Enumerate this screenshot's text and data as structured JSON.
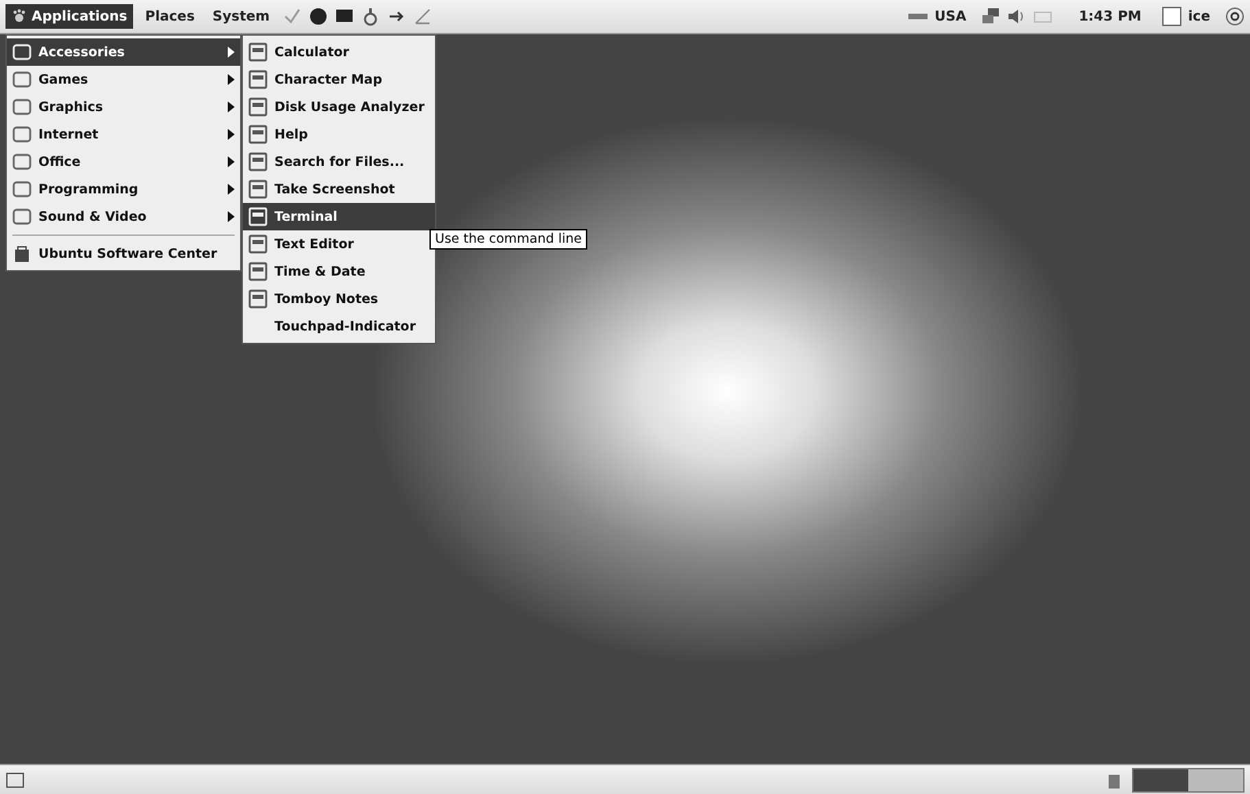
{
  "top_panel": {
    "menus": [
      {
        "label": "Applications",
        "selected": true
      },
      {
        "label": "Places",
        "selected": false
      },
      {
        "label": "System",
        "selected": false
      }
    ],
    "keyboard_layout": "USA",
    "clock": "1:43 PM",
    "user": "ice"
  },
  "applications_menu": {
    "categories": [
      {
        "label": "Accessories",
        "selected": true,
        "has_submenu": true
      },
      {
        "label": "Games",
        "selected": false,
        "has_submenu": true
      },
      {
        "label": "Graphics",
        "selected": false,
        "has_submenu": true
      },
      {
        "label": "Internet",
        "selected": false,
        "has_submenu": true
      },
      {
        "label": "Office",
        "selected": false,
        "has_submenu": true
      },
      {
        "label": "Programming",
        "selected": false,
        "has_submenu": true
      },
      {
        "label": "Sound & Video",
        "selected": false,
        "has_submenu": true
      }
    ],
    "footer_items": [
      {
        "label": "Ubuntu Software Center",
        "selected": false,
        "has_submenu": false
      }
    ]
  },
  "accessories_menu": {
    "items": [
      {
        "label": "Calculator",
        "selected": false,
        "has_icon": true
      },
      {
        "label": "Character Map",
        "selected": false,
        "has_icon": true
      },
      {
        "label": "Disk Usage Analyzer",
        "selected": false,
        "has_icon": true
      },
      {
        "label": "Help",
        "selected": false,
        "has_icon": true
      },
      {
        "label": "Search for Files...",
        "selected": false,
        "has_icon": true
      },
      {
        "label": "Take Screenshot",
        "selected": false,
        "has_icon": true
      },
      {
        "label": "Terminal",
        "selected": true,
        "has_icon": true
      },
      {
        "label": "Text Editor",
        "selected": false,
        "has_icon": true
      },
      {
        "label": "Time & Date",
        "selected": false,
        "has_icon": true
      },
      {
        "label": "Tomboy Notes",
        "selected": false,
        "has_icon": true
      },
      {
        "label": "Touchpad-Indicator",
        "selected": false,
        "has_icon": false
      }
    ]
  },
  "tooltip": "Use the command line"
}
